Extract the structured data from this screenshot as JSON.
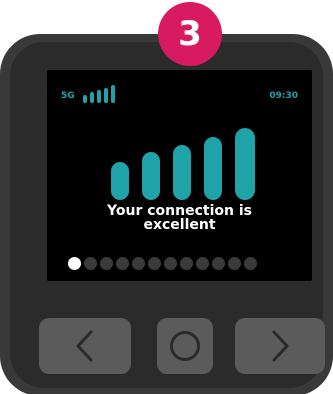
{
  "badge": {
    "step": "3"
  },
  "status": {
    "network": "5G",
    "time": "09:30",
    "signal_bars_active": 5
  },
  "screen": {
    "message_line1": "Your connection is",
    "message_line2": "excellent",
    "signal_level": "5 of 5 bars"
  },
  "pager": {
    "total": 12,
    "current": 1
  },
  "icons": {
    "prev": "chevron-left-icon",
    "ok": "circle-icon",
    "next": "chevron-right-icon"
  },
  "colors": {
    "accent": "#1fa3a9",
    "badge": "#d81b60",
    "device": "#393939",
    "buttons": "#5b5b5b"
  }
}
